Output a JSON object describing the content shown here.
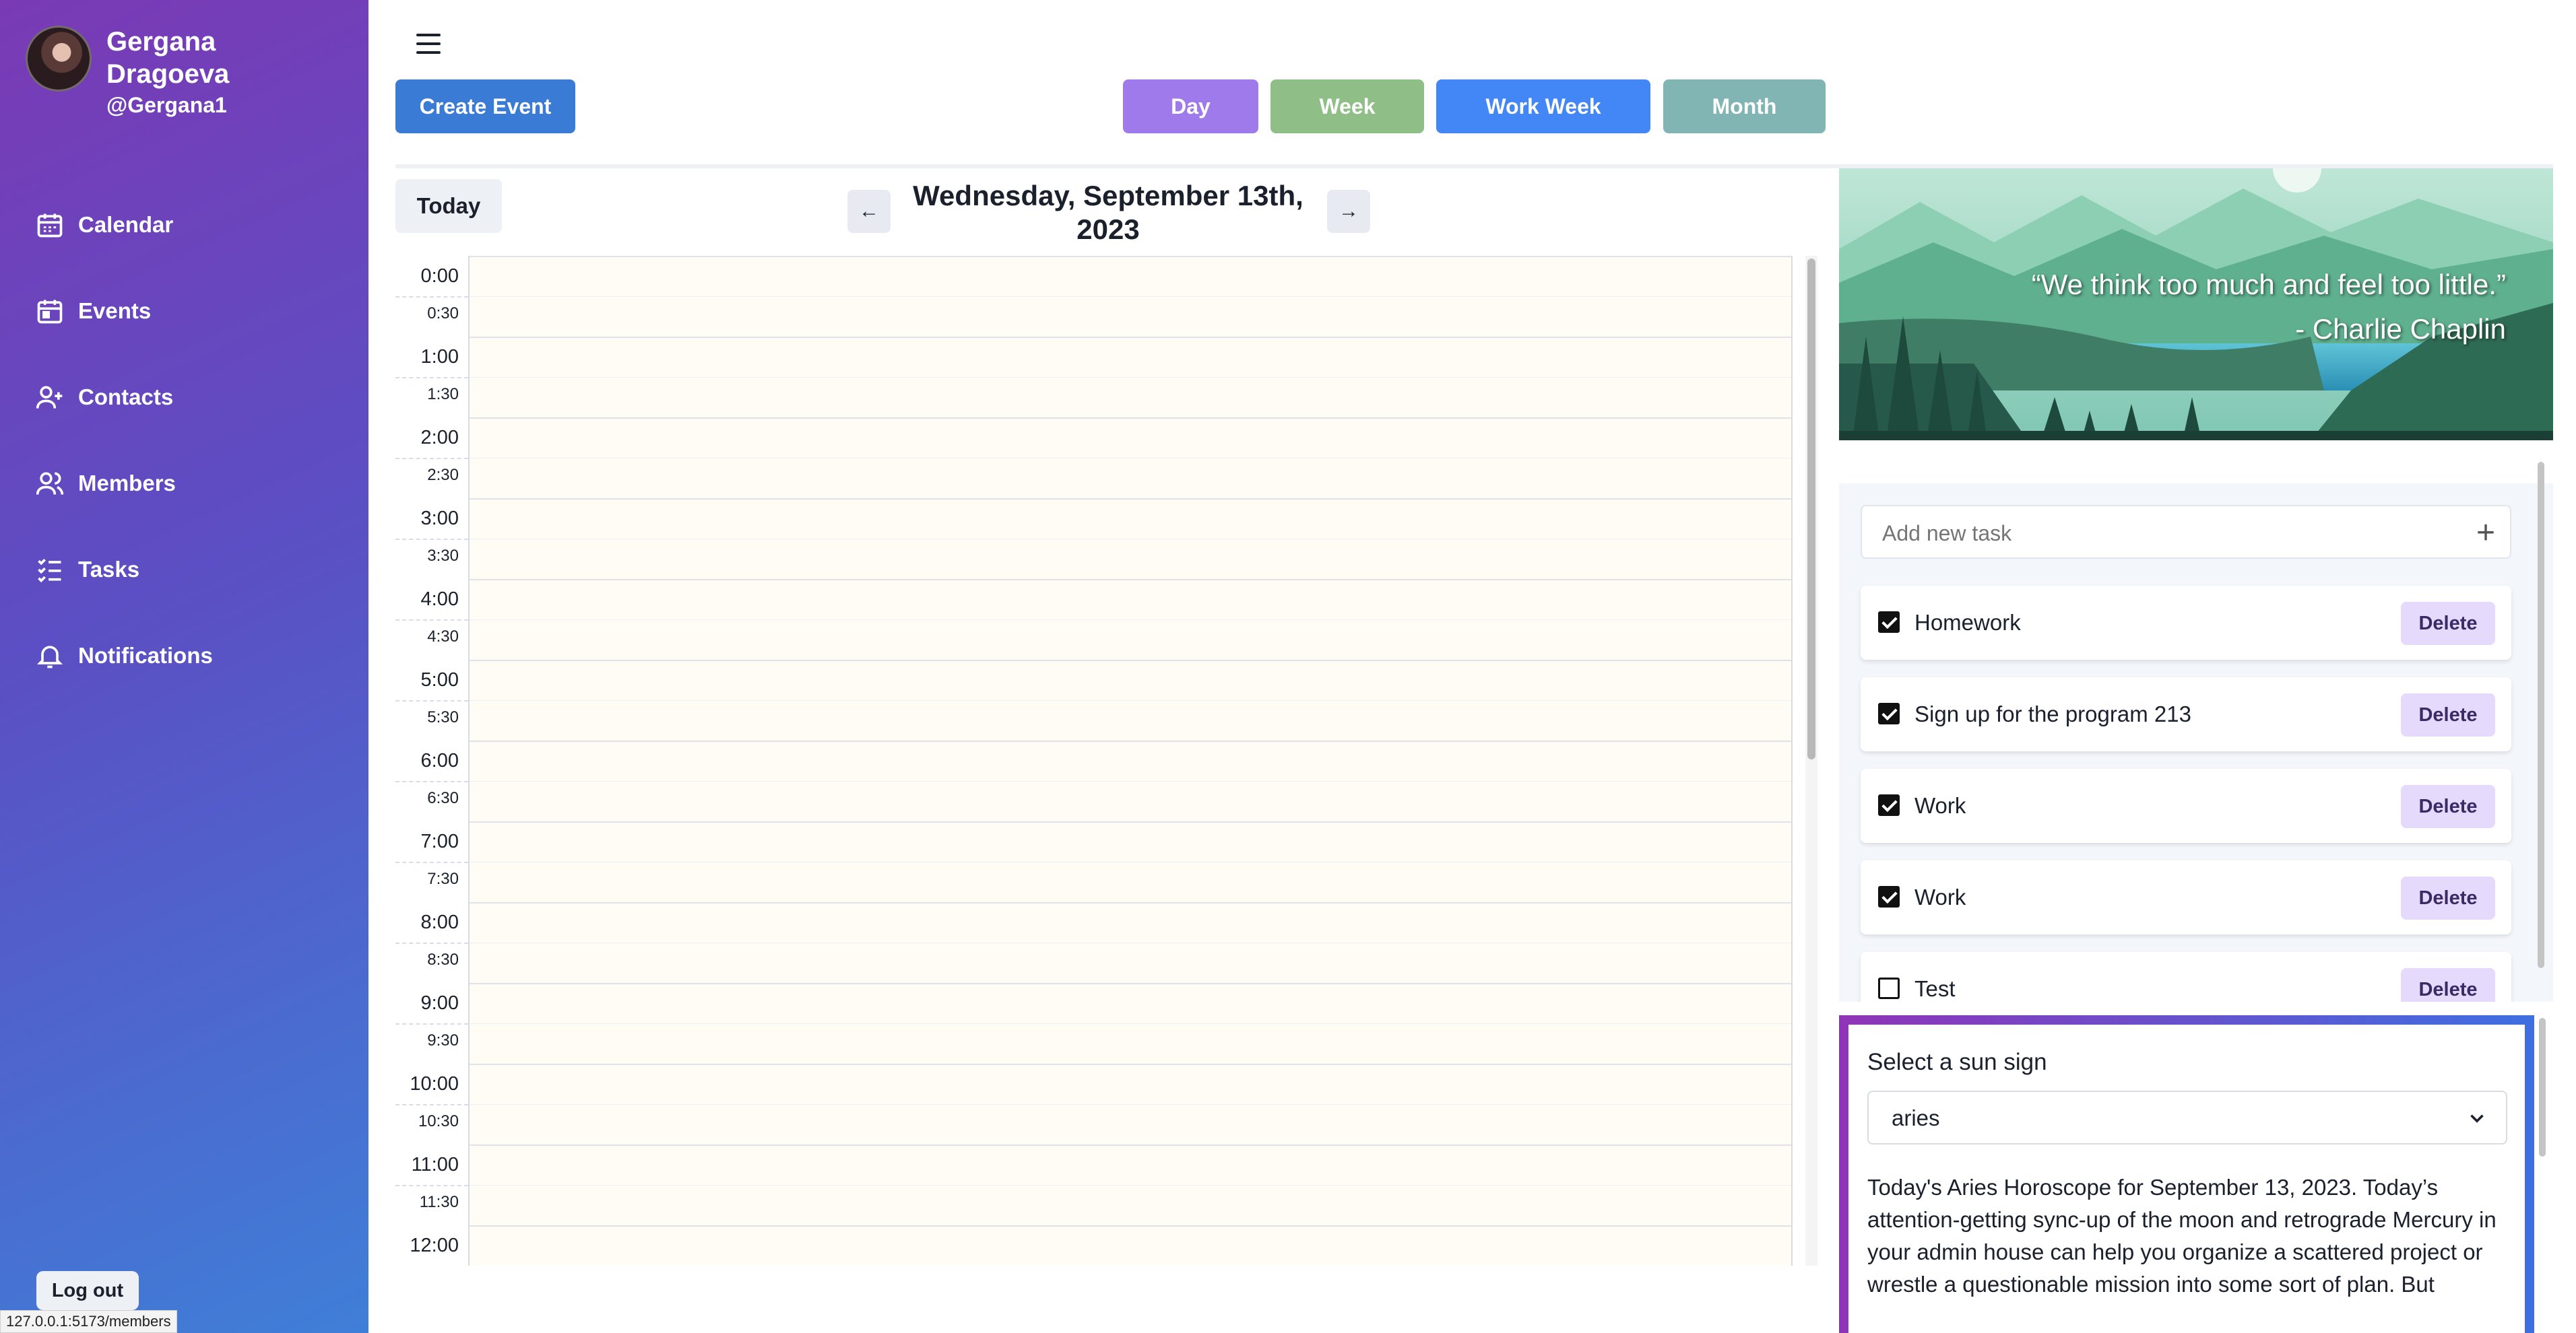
{
  "user": {
    "name": "Gergana Dragoeva",
    "handle": "@Gergana1"
  },
  "nav": [
    {
      "label": "Calendar",
      "icon": "calendar-icon"
    },
    {
      "label": "Events",
      "icon": "calendar-event-icon"
    },
    {
      "label": "Contacts",
      "icon": "user-plus-icon"
    },
    {
      "label": "Members",
      "icon": "users-icon"
    },
    {
      "label": "Tasks",
      "icon": "list-check-icon"
    },
    {
      "label": "Notifications",
      "icon": "bell-icon"
    }
  ],
  "logout_label": "Log out",
  "status_url": "127.0.0.1:5173/members",
  "toolbar": {
    "create_label": "Create Event",
    "views": [
      {
        "label": "Day",
        "color": "#9f7aea"
      },
      {
        "label": "Week",
        "color": "#8fbf87"
      },
      {
        "label": "Work Week",
        "color": "#4287f5"
      },
      {
        "label": "Month",
        "color": "#80b5b3"
      }
    ]
  },
  "calendar": {
    "today_label": "Today",
    "date_line1": "Wednesday, September 13th,",
    "date_line2": "2023",
    "hours": [
      "0:00",
      "1:00",
      "2:00",
      "3:00",
      "4:00",
      "5:00",
      "6:00",
      "7:00",
      "8:00",
      "9:00",
      "10:00",
      "11:00",
      "12:00"
    ],
    "halves": [
      "0:30",
      "1:30",
      "2:30",
      "3:30",
      "4:30",
      "5:30",
      "6:30",
      "7:30",
      "8:30",
      "9:30",
      "10:30",
      "11:30"
    ]
  },
  "quote": {
    "text": "“We think too much and feel too little.”",
    "author": "- Charlie Chaplin"
  },
  "tasks": {
    "placeholder": "Add new task",
    "delete_label": "Delete",
    "items": [
      {
        "label": "Homework",
        "checked": true
      },
      {
        "label": "Sign up for the program 213",
        "checked": true
      },
      {
        "label": "Work",
        "checked": true
      },
      {
        "label": "Work",
        "checked": true
      },
      {
        "label": "Test",
        "checked": false
      }
    ]
  },
  "horoscope": {
    "label": "Select a sun sign",
    "selected": "aries",
    "text": "Today's Aries Horoscope for September 13, 2023. Today’s attention-getting sync-up of the moon and retrograde Mercury in your admin house can help you organize a scattered project or wrestle a questionable mission into some sort of plan. But"
  }
}
